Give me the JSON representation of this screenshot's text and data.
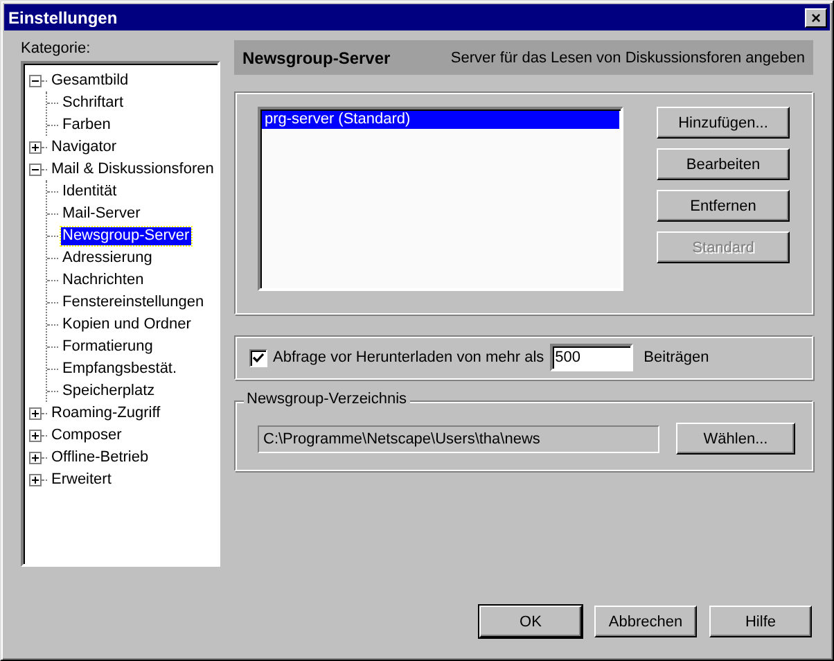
{
  "window": {
    "title": "Einstellungen",
    "close_label": "×"
  },
  "category_label": "Kategorie:",
  "tree": [
    {
      "label": "Gesamtbild",
      "expanded": true,
      "selected": false,
      "children": [
        {
          "label": "Schriftart",
          "selected": false
        },
        {
          "label": "Farben",
          "selected": false
        }
      ]
    },
    {
      "label": "Navigator",
      "expanded": false,
      "selected": false
    },
    {
      "label": "Mail & Diskussionsforen",
      "expanded": true,
      "selected": false,
      "children": [
        {
          "label": "Identität",
          "selected": false
        },
        {
          "label": "Mail-Server",
          "selected": false
        },
        {
          "label": "Newsgroup-Server",
          "selected": true
        },
        {
          "label": "Adressierung",
          "selected": false
        },
        {
          "label": "Nachrichten",
          "selected": false
        },
        {
          "label": "Fenstereinstellungen",
          "selected": false
        },
        {
          "label": "Kopien und Ordner",
          "selected": false
        },
        {
          "label": "Formatierung",
          "selected": false
        },
        {
          "label": "Empfangsbestät.",
          "selected": false
        },
        {
          "label": "Speicherplatz",
          "selected": false
        }
      ]
    },
    {
      "label": "Roaming-Zugriff",
      "expanded": false,
      "selected": false
    },
    {
      "label": "Composer",
      "expanded": false,
      "selected": false
    },
    {
      "label": "Offline-Betrieb",
      "expanded": false,
      "selected": false
    },
    {
      "label": "Erweitert",
      "expanded": false,
      "selected": false
    }
  ],
  "header": {
    "title": "Newsgroup-Server",
    "description": "Server für das Lesen von Diskussionsforen angeben"
  },
  "servers": [
    {
      "label": "prg-server (Standard)",
      "selected": true
    }
  ],
  "server_buttons": [
    {
      "label": "Hinzufügen...",
      "disabled": false
    },
    {
      "label": "Bearbeiten",
      "disabled": false
    },
    {
      "label": "Entfernen",
      "disabled": false
    },
    {
      "label": "Standard",
      "disabled": true
    }
  ],
  "download_prompt": {
    "checked": true,
    "label": "Abfrage vor Herunterladen von mehr als",
    "value": "500",
    "suffix": "Beiträgen"
  },
  "directory": {
    "legend": "Newsgroup-Verzeichnis",
    "path": "C:\\Programme\\Netscape\\Users\\tha\\news",
    "button": "Wählen..."
  },
  "buttons": [
    {
      "label": "OK",
      "default": true
    },
    {
      "label": "Abbrechen",
      "default": false
    },
    {
      "label": "Hilfe",
      "default": false
    }
  ]
}
